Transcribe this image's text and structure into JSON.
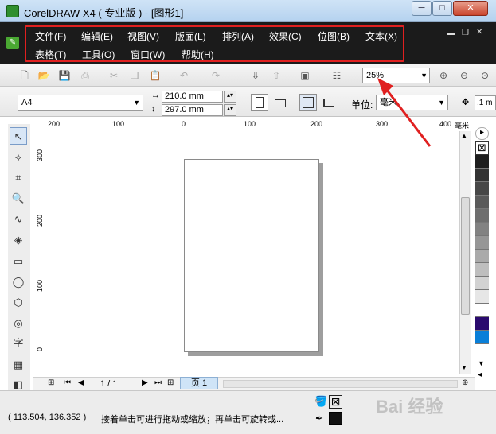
{
  "window": {
    "title": "CorelDRAW X4 ( 专业版 ) - [图形1]",
    "min_label": "─",
    "max_label": "□",
    "close_label": "✕"
  },
  "menu": {
    "row1": [
      "文件(F)",
      "编辑(E)",
      "视图(V)",
      "版面(L)",
      "排列(A)",
      "效果(C)",
      "位图(B)",
      "文本(X)"
    ],
    "row2": [
      "表格(T)",
      "工具(O)",
      "窗口(W)",
      "帮助(H)"
    ],
    "highlight_color": "#e02020"
  },
  "toolbar": {
    "zoom_value": "25%"
  },
  "property_bar": {
    "paper_size": "A4",
    "width": "210.0 mm",
    "height": "297.0 mm",
    "unit_label": "单位:",
    "unit_value": "毫米",
    "nudge_value": ".1 m"
  },
  "ruler": {
    "h_ticks": [
      "200",
      "100",
      "0",
      "100",
      "200",
      "300",
      "400"
    ],
    "h_unit": "毫米",
    "v_ticks": [
      "300",
      "200",
      "100",
      "0"
    ]
  },
  "pagebar": {
    "page_count": "1 / 1",
    "page_tab": "页 1"
  },
  "status": {
    "coords": "( 113.504, 136.352 )",
    "hint": "接着单击可进行拖动或缩放；再单击可旋转或..."
  },
  "toolbox": {
    "text_tool": "字"
  },
  "palette": [
    "#ffffff",
    "#1e1e1e",
    "#333333",
    "#474747",
    "#5a5a5a",
    "#6e6e6e",
    "#828282",
    "#969696",
    "#aaaaaa",
    "#bebebe",
    "#d2d2d2",
    "#e6e6e6",
    "#ffffff",
    "#2a0a6e",
    "#0a7fd8",
    "#0a9a4a"
  ],
  "watermark": "Bai 经验"
}
